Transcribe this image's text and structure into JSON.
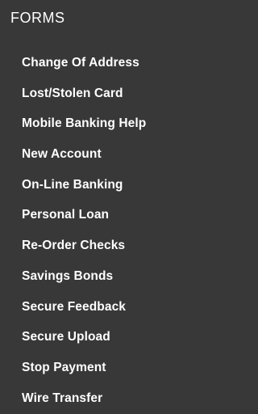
{
  "heading": "FORMS",
  "links": [
    {
      "label": "Change Of Address"
    },
    {
      "label": "Lost/Stolen Card"
    },
    {
      "label": "Mobile Banking Help"
    },
    {
      "label": "New Account"
    },
    {
      "label": "On-Line Banking"
    },
    {
      "label": "Personal Loan"
    },
    {
      "label": "Re-Order Checks"
    },
    {
      "label": "Savings Bonds"
    },
    {
      "label": "Secure Feedback"
    },
    {
      "label": "Secure Upload"
    },
    {
      "label": "Stop Payment"
    },
    {
      "label": "Wire Transfer"
    }
  ],
  "colors": {
    "background": "#383838",
    "text": "#ffffff"
  }
}
